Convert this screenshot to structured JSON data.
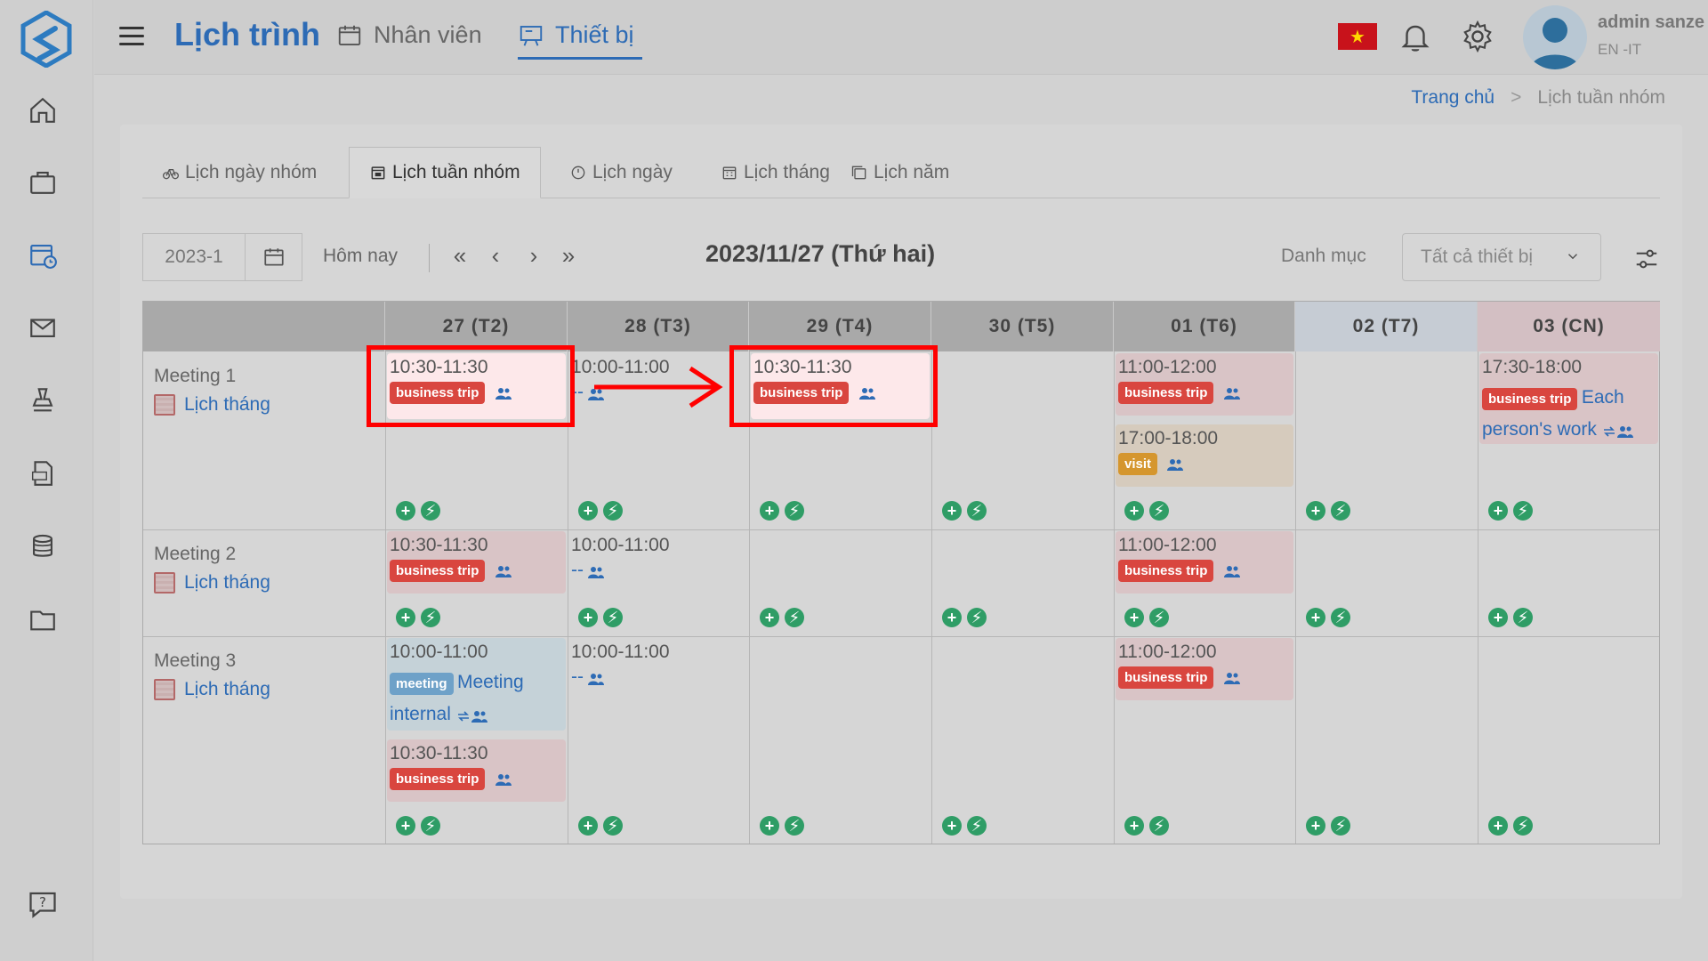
{
  "header": {
    "app_title": "Lịch trình",
    "tab_staff": "Nhân viên",
    "tab_device": "Thiết bị",
    "user_name": "admin sanze",
    "user_sub": "EN -IT",
    "flag_symbol": "★"
  },
  "breadcrumb": {
    "home": "Trang chủ",
    "sep": ">",
    "current": "Lịch tuần nhóm"
  },
  "tabs": [
    {
      "label": "Lịch ngày nhóm"
    },
    {
      "label": "Lịch tuần nhóm"
    },
    {
      "label": "Lịch ngày"
    },
    {
      "label": "Lịch tháng"
    },
    {
      "label": "Lịch năm"
    }
  ],
  "toolbar": {
    "date_value": "2023-1",
    "today": "Hôm nay",
    "nav_first": "«",
    "nav_prev": "‹",
    "nav_next": "›",
    "nav_last": "»",
    "current_date": "2023/11/27  (Thứ hai)",
    "category_label": "Danh mục",
    "category_value": "Tất cả thiết bị"
  },
  "days": [
    {
      "label": "27  (T2)"
    },
    {
      "label": "28  (T3)"
    },
    {
      "label": "29  (T4)"
    },
    {
      "label": "30  (T5)"
    },
    {
      "label": "01  (T6)"
    },
    {
      "label": "02  (T7)"
    },
    {
      "label": "03  (CN)"
    }
  ],
  "rooms": [
    {
      "name": "Meeting 1",
      "link": "Lịch tháng"
    },
    {
      "name": "Meeting 2",
      "link": "Lịch tháng"
    },
    {
      "name": "Meeting 3",
      "link": "Lịch tháng"
    }
  ],
  "events": {
    "r1d1": {
      "time": "10:30-11:30",
      "badge": "business trip"
    },
    "r1d2": {
      "time": "10:00-11:00",
      "text": "--"
    },
    "r1d3": {
      "time": "10:30-11:30",
      "badge": "business trip"
    },
    "r1d5a": {
      "time": "11:00-12:00",
      "badge": "business trip"
    },
    "r1d5b": {
      "time": "17:00-18:00",
      "badge": "visit"
    },
    "r1d7": {
      "time": "17:30-18:00",
      "badge": "business trip",
      "text1": "Each",
      "text2": "person's work"
    },
    "r2d1": {
      "time": "10:30-11:30",
      "badge": "business trip"
    },
    "r2d2": {
      "time": "10:00-11:00",
      "text": "--"
    },
    "r2d5": {
      "time": "11:00-12:00",
      "badge": "business trip"
    },
    "r3d1a": {
      "time": "10:00-11:00",
      "badge": "meeting",
      "text1": "Meeting",
      "text2": "internal"
    },
    "r3d1b": {
      "time": "10:30-11:30",
      "badge": "business trip"
    },
    "r3d2": {
      "time": "10:00-11:00",
      "text": "--"
    },
    "r3d5": {
      "time": "11:00-12:00",
      "badge": "business trip"
    }
  },
  "add_glyph": "+",
  "quick_glyph": "⚡",
  "colors": {
    "accent": "#2d6bb5",
    "badge_red": "#d9463f",
    "badge_orange": "#d5962e",
    "badge_blue": "#6ea1c8",
    "add_green": "#2f9d66",
    "highlight": "#ff0000"
  }
}
